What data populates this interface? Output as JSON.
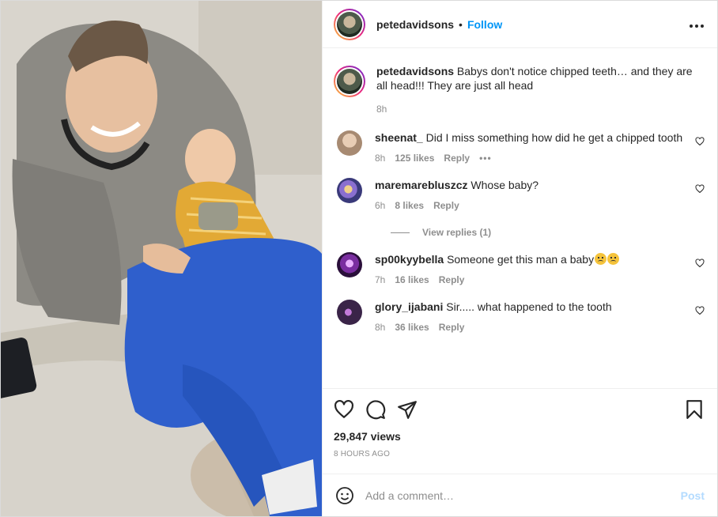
{
  "post": {
    "username": "petedavidsons",
    "follow_label": "Follow",
    "separator": "•",
    "more_label": "•••"
  },
  "caption": {
    "username": "petedavidsons",
    "text": "Babys don't notice chipped teeth… and they are all head!!! They are just all head",
    "time": "8h"
  },
  "comments": [
    {
      "username": "sheenat_",
      "text": "Did I miss something how did he get a chipped tooth",
      "time": "8h",
      "likes": "125 likes",
      "reply": "Reply",
      "more": "•••",
      "avatar_color": "#b9a08a"
    },
    {
      "username": "maremarebluszcz",
      "text": "Whose baby?",
      "time": "6h",
      "likes": "8 likes",
      "reply": "Reply",
      "avatar_color": "#6a5fb0"
    },
    {
      "username": "sp00kyybella",
      "text": "Someone get this man a baby",
      "time": "7h",
      "likes": "16 likes",
      "reply": "Reply",
      "avatar_color": "#6d2a8a"
    },
    {
      "username": "glory_ijabani",
      "text": "Sir..... what happened to the tooth",
      "time": "8h",
      "likes": "36 likes",
      "reply": "Reply",
      "avatar_color": "#3a2448"
    }
  ],
  "view_replies": "View replies (1)",
  "stats": {
    "views": "29,847 views",
    "posted": "8 HOURS AGO"
  },
  "composer": {
    "placeholder": "Add a comment…",
    "post_label": "Post"
  },
  "icons": [
    "more-icon",
    "heart-icon",
    "comment-icon",
    "share-icon",
    "bookmark-icon",
    "emoji-icon"
  ]
}
